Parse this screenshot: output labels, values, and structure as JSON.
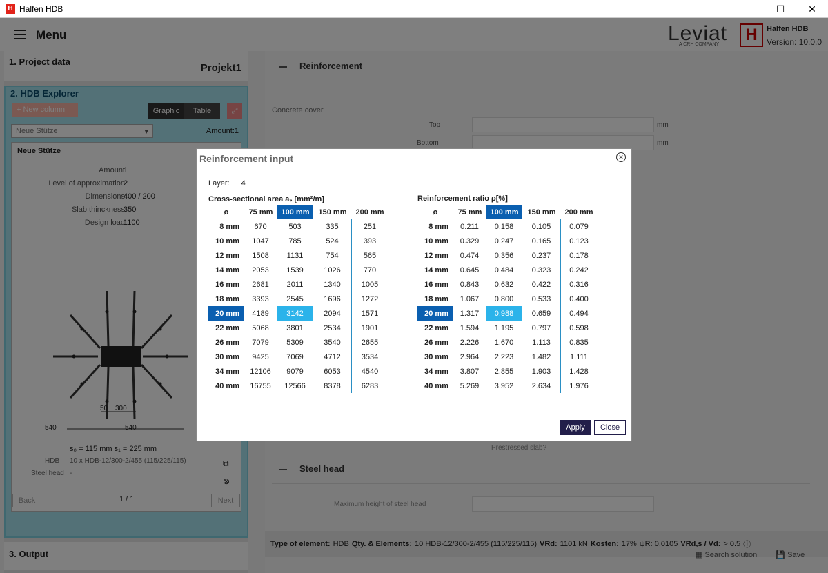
{
  "window": {
    "title": "Halfen HDB",
    "minimize": "—",
    "maximize": "☐",
    "close": "✕"
  },
  "topbar": {
    "menu_label": "Menu",
    "leviat": "Leviat",
    "leviat_sub": "A CRH COMPANY",
    "brand": "Halfen HDB",
    "version": "Version: 10.0.0"
  },
  "project": {
    "title": "1. Project data",
    "name": "Projekt1"
  },
  "explorer": {
    "title": "2. HDB Explorer",
    "new_column": "+ New column",
    "view_graphic": "Graphic",
    "view_table": "Table",
    "selected_column": "Neue Stütze",
    "amount_label": "Amount:1",
    "panel_title": "Neue Stütze",
    "props": [
      {
        "k": "Amount",
        "v": "1"
      },
      {
        "k": "Level of approximation",
        "v": "2"
      },
      {
        "k": "Dimensions",
        "v": "400 / 200"
      },
      {
        "k": "Slab thinckness",
        "v": "350"
      },
      {
        "k": "Design load",
        "v": "1100"
      }
    ],
    "dims": {
      "d1": "50",
      "d2": "300",
      "d3": "540",
      "d4": "540"
    },
    "spacing": "s₀ = 115 mm  s₁ = 225 mm",
    "hdb_label": "HDB",
    "hdb_value": "10 x HDB-12/300-2/455 (115/225/115)",
    "steel_label": "Steel head",
    "steel_value": "-",
    "back": "Back",
    "next": "Next",
    "page": "1 / 1"
  },
  "output": {
    "title": "3. Output"
  },
  "right": {
    "reinforcement_title": "Reinforcement",
    "concrete_cover": "Concrete cover",
    "top_label": "Top",
    "bottom_label": "Bottom",
    "unit": "mm",
    "prestressed": "Prestressed slab?",
    "steel_head_title": "Steel head",
    "max_height": "Maximum height of steel head"
  },
  "status": {
    "type_label": "Type of element:",
    "type_value": "HDB",
    "qty_label": "Qty. & Elements:",
    "qty_value": "10 HDB-12/300-2/455 (115/225/115)",
    "vrd_label": "VRd:",
    "vrd_value": "1101 kN",
    "kosten_label": "Kosten:",
    "kosten_value": "17%",
    "psi": "ψR: 0.0105",
    "ratio_label": "VRd,s / Vd:",
    "ratio_value": "> 0.5",
    "search": "Search solution",
    "save": "Save"
  },
  "dialog": {
    "title": "Reinforcement input",
    "layer_label": "Layer:",
    "layer_value": "4",
    "area_caption": "Cross-sectional area aₛ [mm²/m]",
    "ratio_caption": "Reinforcement ratio ρ[%]",
    "col_headers": [
      "ø",
      "75 mm",
      "100 mm",
      "150 mm",
      "200 mm"
    ],
    "rows": [
      "8 mm",
      "10 mm",
      "12 mm",
      "14 mm",
      "16 mm",
      "18 mm",
      "20 mm",
      "22 mm",
      "26 mm",
      "30 mm",
      "34 mm",
      "40 mm"
    ],
    "area": [
      [
        "670",
        "503",
        "335",
        "251"
      ],
      [
        "1047",
        "785",
        "524",
        "393"
      ],
      [
        "1508",
        "1131",
        "754",
        "565"
      ],
      [
        "2053",
        "1539",
        "1026",
        "770"
      ],
      [
        "2681",
        "2011",
        "1340",
        "1005"
      ],
      [
        "3393",
        "2545",
        "1696",
        "1272"
      ],
      [
        "4189",
        "3142",
        "2094",
        "1571"
      ],
      [
        "5068",
        "3801",
        "2534",
        "1901"
      ],
      [
        "7079",
        "5309",
        "3540",
        "2655"
      ],
      [
        "9425",
        "7069",
        "4712",
        "3534"
      ],
      [
        "12106",
        "9079",
        "6053",
        "4540"
      ],
      [
        "16755",
        "12566",
        "8378",
        "6283"
      ]
    ],
    "ratio": [
      [
        "0.211",
        "0.158",
        "0.105",
        "0.079"
      ],
      [
        "0.329",
        "0.247",
        "0.165",
        "0.123"
      ],
      [
        "0.474",
        "0.356",
        "0.237",
        "0.178"
      ],
      [
        "0.645",
        "0.484",
        "0.323",
        "0.242"
      ],
      [
        "0.843",
        "0.632",
        "0.422",
        "0.316"
      ],
      [
        "1.067",
        "0.800",
        "0.533",
        "0.400"
      ],
      [
        "1.317",
        "0.988",
        "0.659",
        "0.494"
      ],
      [
        "1.594",
        "1.195",
        "0.797",
        "0.598"
      ],
      [
        "2.226",
        "1.670",
        "1.113",
        "0.835"
      ],
      [
        "2.964",
        "2.223",
        "1.482",
        "1.111"
      ],
      [
        "3.807",
        "2.855",
        "1.903",
        "1.428"
      ],
      [
        "5.269",
        "3.952",
        "2.634",
        "1.976"
      ]
    ],
    "selected_row": 6,
    "selected_col": 1,
    "apply": "Apply",
    "close": "Close",
    "colors": {
      "accent": "#0a5fb0",
      "highlight": "#2bb3ea",
      "apply": "#221e4a"
    }
  }
}
